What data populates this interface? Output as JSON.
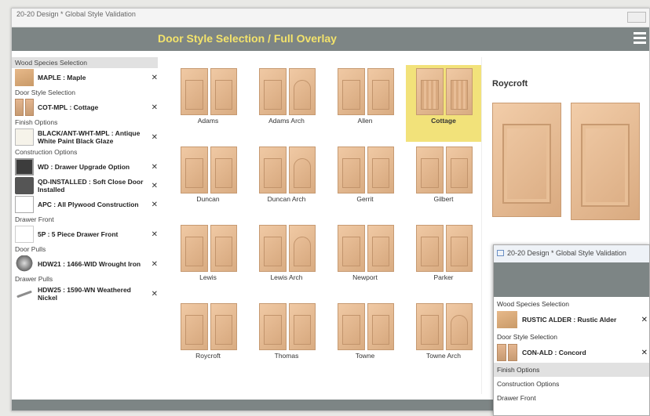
{
  "window": {
    "title": "20-20 Design * Global Style Validation"
  },
  "header": {
    "title": "Door Style Selection / Full Overlay"
  },
  "sidebar": {
    "sections": [
      {
        "label": "Wood Species Selection",
        "active": true,
        "items": [
          {
            "text": "MAPLE : Maple",
            "thumb": "wood"
          }
        ]
      },
      {
        "label": "Door Style Selection",
        "items": [
          {
            "text": "COT-MPL : Cottage",
            "thumb": "door2"
          }
        ]
      },
      {
        "label": "Finish Options",
        "items": [
          {
            "text": "BLACK/ANT-WHT-MPL : Antique White Paint Black Glaze",
            "thumb": "white"
          }
        ]
      },
      {
        "label": "Construction Options",
        "items": [
          {
            "text": "WD : Drawer Upgrade Option",
            "thumb": "drawer"
          },
          {
            "text": "QD-INSTALLED : Soft Close Door Installed",
            "thumb": "qd"
          },
          {
            "text": "APC : All Plywood Construction",
            "thumb": "apc"
          }
        ]
      },
      {
        "label": "Drawer Front",
        "items": [
          {
            "text": "5P : 5 Piece Drawer Front",
            "thumb": "fp"
          }
        ]
      },
      {
        "label": "Door Pulls",
        "items": [
          {
            "text": "HDW21 : 1466-WID Wrought Iron",
            "thumb": "knob"
          }
        ]
      },
      {
        "label": "Drawer Pulls",
        "items": [
          {
            "text": "HDW25 : 1590-WN Weathered Nickel",
            "thumb": "pull"
          }
        ]
      }
    ],
    "remove_glyph": "✕"
  },
  "doors": [
    {
      "name": "Adams",
      "style": "plain"
    },
    {
      "name": "Adams Arch",
      "style": "arch"
    },
    {
      "name": "Allen",
      "style": "plain"
    },
    {
      "name": "Cottage",
      "style": "bead",
      "selected": true
    },
    {
      "name": "Duncan",
      "style": "plain"
    },
    {
      "name": "Duncan Arch",
      "style": "arch"
    },
    {
      "name": "Gerrit",
      "style": "plain"
    },
    {
      "name": "Gilbert",
      "style": "plain"
    },
    {
      "name": "Lewis",
      "style": "plain"
    },
    {
      "name": "Lewis Arch",
      "style": "arch"
    },
    {
      "name": "Newport",
      "style": "plain"
    },
    {
      "name": "Parker",
      "style": "plain"
    },
    {
      "name": "Roycroft",
      "style": "plain"
    },
    {
      "name": "Thomas",
      "style": "plain"
    },
    {
      "name": "Towne",
      "style": "plain"
    },
    {
      "name": "Towne Arch",
      "style": "arch"
    }
  ],
  "preview": {
    "title": "Roycroft"
  },
  "overlay_window": {
    "title": "20-20 Design * Global Style Validation",
    "sections": [
      {
        "label": "Wood Species Selection",
        "item": "RUSTIC ALDER : Rustic Alder"
      },
      {
        "label": "Door Style Selection",
        "item": "CON-ALD : Concord"
      },
      {
        "label": "Finish Options",
        "active": true
      },
      {
        "label": "Construction Options"
      },
      {
        "label": "Drawer Front"
      }
    ]
  },
  "colors": {
    "header": "#7d8585",
    "title_accent": "#f3e36b",
    "selected": "#f2e27a"
  }
}
